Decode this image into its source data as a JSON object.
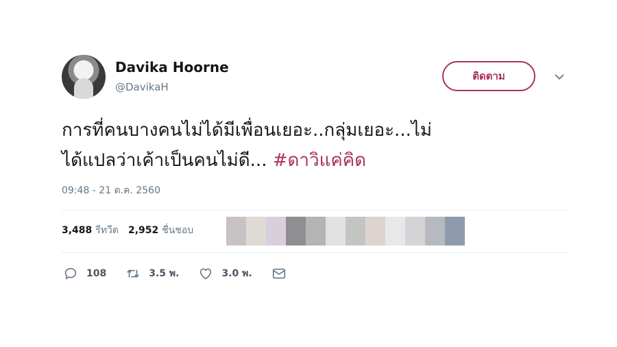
{
  "user": {
    "display_name": "Davika Hoorne",
    "handle": "@DavikaH"
  },
  "follow_button": {
    "label": "ติดตาม"
  },
  "tweet": {
    "text_line1": "การที่คนบางคนไม่ได้มีเพื่อนเยอะ..กลุ่มเยอะ...ไม่",
    "text_line2": "ได้แปลว่าเค้าเป็นคนไม่ดี...",
    "hashtag": "#ดาวิแค่คิด",
    "timestamp": "09:48 - 21 ต.ค. 2560"
  },
  "stats": {
    "retweets_count": "3,488",
    "retweets_label": "รีทวีต",
    "likes_count": "2,952",
    "likes_label": "ชื่นชอบ"
  },
  "actions": {
    "replies": "108",
    "retweets": "3.5 พ.",
    "likes": "3.0 พ."
  },
  "colors": {
    "accent": "#a8325a",
    "secondary_text": "#657786",
    "divider": "#e6ecf0"
  }
}
